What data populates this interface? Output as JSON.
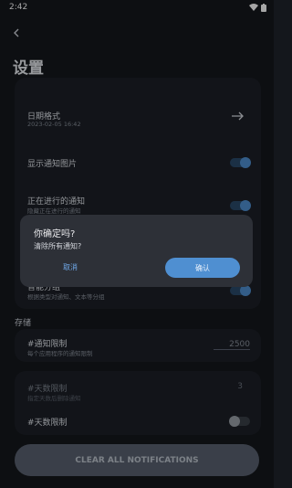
{
  "status_bar": {
    "time": "2:42"
  },
  "header": {
    "title": "设置"
  },
  "settings": {
    "date_format": {
      "label": "日期格式",
      "value": "2023-02-05 16:42"
    },
    "show_notification_image": {
      "label": "显示通知图片",
      "enabled": true
    },
    "ongoing_notifications": {
      "label": "正在进行的通知",
      "sub": "隐藏正在进行的通知",
      "enabled": true
    },
    "smart_grouping": {
      "label": "智能分组",
      "sub": "根据类型对通知、文本等分组",
      "enabled": true
    }
  },
  "storage": {
    "section_title": "存储",
    "notification_limit": {
      "label": "#通知限制",
      "sub": "每个应用程序的通知限制",
      "value": "2500"
    },
    "days_limit": {
      "label": "#天数限制",
      "sub": "指定天数后删除通知",
      "value": "3"
    },
    "days_limit_toggle": {
      "label": "#天数限制",
      "enabled": false
    }
  },
  "dialog": {
    "title": "你确定吗?",
    "message": "清除所有通知?",
    "cancel_label": "取消",
    "confirm_label": "确认"
  },
  "footer": {
    "clear_button_label": "CLEAR ALL NOTIFICATIONS"
  },
  "colors": {
    "accent": "#4f8fd1",
    "background": "#14171c",
    "card": "#1c2027"
  }
}
